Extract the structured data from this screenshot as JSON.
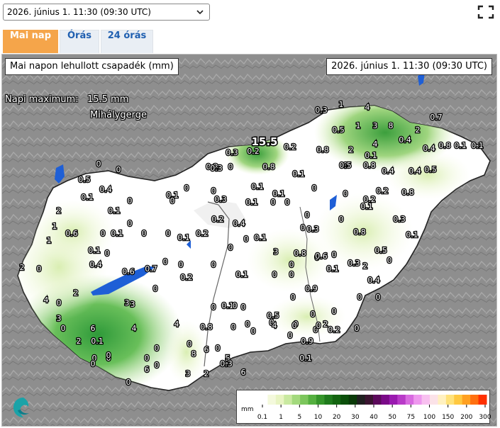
{
  "header": {
    "date_select_value": "2026. június 1. 11:30 (09:30  UTC)",
    "fullscreen_icon": "fullscreen-icon"
  },
  "tabs": [
    {
      "label": "Mai nap",
      "active": true
    },
    {
      "label": "Órás",
      "active": false
    },
    {
      "label": "24 órás",
      "active": false
    }
  ],
  "map": {
    "title": "Mai napon lehullott csapadék (mm)",
    "timestamp": "2026. június 1. 11:30 (09:30 UTC)",
    "max_label": "Napi maximum:   15.5 mm",
    "max_location": "Mihálygerge",
    "max_value_label": "15.5",
    "station_values": [
      "0.3",
      "1",
      "4",
      "0.7",
      "1",
      "3",
      "8",
      "2",
      "0.5",
      "0.4",
      "0.2",
      "0.8",
      "0.1",
      "0.1",
      "0.8",
      "2",
      "4",
      "0.4",
      "0.3",
      "0.2",
      "0.8",
      "0.1",
      "0.4",
      "0.4",
      "0.2",
      "0",
      "0.1",
      "0.3",
      "0.1",
      "0.5",
      "0",
      "0.8",
      "0.2",
      "0.4",
      "0.1",
      "0",
      "0",
      "0",
      "0.1",
      "0.2",
      "0",
      "0.4",
      "0.1",
      "0.5",
      "0",
      "0",
      "0",
      "0.3",
      "0.1",
      "0",
      "2",
      "0.1",
      "0",
      "0",
      "0",
      "0.5",
      "0.1",
      "0.1",
      "0",
      "0",
      "0.2",
      "0.8",
      "0.3",
      "0.1",
      "1",
      "0.6",
      "0",
      "0.1",
      "0",
      "0",
      "0.1",
      "0.1",
      "0",
      "0.2",
      "1",
      "0",
      "0",
      "0",
      "0.3",
      "0.8",
      "0.5",
      "0",
      "0.4",
      "0.6",
      "0",
      "0",
      "0",
      "3",
      "0.8",
      "0.6",
      "0.1",
      "0.3",
      "2",
      "0",
      "0.7",
      "0.4",
      "0",
      "0",
      "0",
      "0.2",
      "2",
      "0",
      "0",
      "3",
      "0",
      "0.1",
      "0",
      "0",
      "0.9",
      "0",
      "0",
      "0",
      "0",
      "0.5",
      "0",
      "0",
      "3",
      "4",
      "2",
      "3",
      "0.1",
      "0",
      "0",
      "0",
      "0",
      "0",
      "0",
      "6",
      "4",
      "4",
      "0.8",
      "0",
      "0",
      "0",
      "0",
      "0",
      "2",
      "0.1",
      "0",
      "0",
      "5",
      "6",
      "0.9",
      "0.2",
      "0",
      "0",
      "0",
      "0",
      "0",
      "8",
      "6",
      "2",
      "4",
      "0.1",
      "0",
      "0",
      "0",
      "6",
      "3",
      "2",
      "0.3",
      "0"
    ],
    "logo_icon": "met-service-logo-icon"
  },
  "legend": {
    "unit": "mm",
    "labels": [
      "0.1",
      "1",
      "5",
      "10",
      "20",
      "30",
      "40",
      "50",
      "75",
      "100",
      "150",
      "200",
      "300"
    ],
    "colors": [
      "#ffffff",
      "#f4f9dc",
      "#e8f4c2",
      "#c9e9a0",
      "#a3d97d",
      "#7cc65c",
      "#55b040",
      "#35952a",
      "#1f7a1c",
      "#136410",
      "#0b4f0a",
      "#0a3a08",
      "#202020",
      "#3a1530",
      "#5c0a5c",
      "#7a0a88",
      "#9a1ab0",
      "#b83ac8",
      "#d86ae0",
      "#ee98ee",
      "#f8c0f0",
      "#fbe2e8",
      "#fff1c0",
      "#ffe27a",
      "#ffc840",
      "#ffa020",
      "#ff7010",
      "#ff3000"
    ]
  }
}
